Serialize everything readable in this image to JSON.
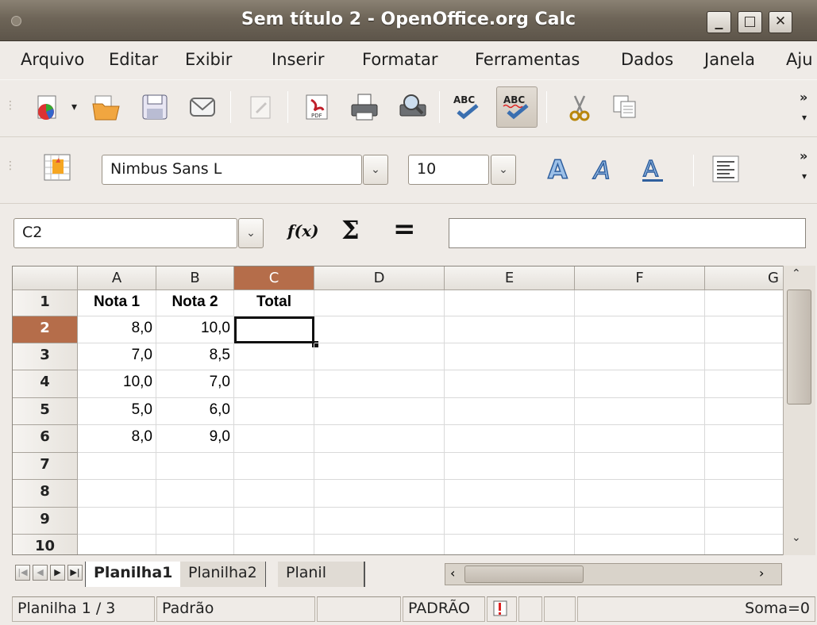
{
  "window": {
    "title": "Sem título 2 - OpenOffice.org Calc",
    "minimize_label": "_",
    "maximize_label": "□",
    "close_label": "✕"
  },
  "menu": {
    "items": [
      "Arquivo",
      "Editar",
      "Exibir",
      "Inserir",
      "Formatar",
      "Ferramentas",
      "Dados",
      "Janela",
      "Aju"
    ]
  },
  "toolbar": {
    "font_name": "Nimbus Sans L",
    "font_size": "10"
  },
  "formula_bar": {
    "name_box": "C2",
    "function_wizard_label": "f(x)",
    "sum_label": "Σ",
    "function_label": "=",
    "input_value": ""
  },
  "sheet": {
    "columns": [
      "A",
      "B",
      "C",
      "D",
      "E",
      "F",
      "G"
    ],
    "rows": [
      {
        "num": "1",
        "cells": [
          "Nota 1",
          "Nota 2",
          "Total",
          "",
          "",
          "",
          ""
        ]
      },
      {
        "num": "2",
        "cells": [
          "8,0",
          "10,0",
          "",
          "",
          "",
          "",
          ""
        ]
      },
      {
        "num": "3",
        "cells": [
          "7,0",
          "8,5",
          "",
          "",
          "",
          "",
          ""
        ]
      },
      {
        "num": "4",
        "cells": [
          "10,0",
          "7,0",
          "",
          "",
          "",
          "",
          ""
        ]
      },
      {
        "num": "5",
        "cells": [
          "5,0",
          "6,0",
          "",
          "",
          "",
          "",
          ""
        ]
      },
      {
        "num": "6",
        "cells": [
          "8,0",
          "9,0",
          "",
          "",
          "",
          "",
          ""
        ]
      },
      {
        "num": "7",
        "cells": [
          "",
          "",
          "",
          "",
          "",
          "",
          ""
        ]
      },
      {
        "num": "8",
        "cells": [
          "",
          "",
          "",
          "",
          "",
          "",
          ""
        ]
      },
      {
        "num": "9",
        "cells": [
          "",
          "",
          "",
          "",
          "",
          "",
          ""
        ]
      },
      {
        "num": "10",
        "cells": [
          "",
          "",
          "",
          "",
          "",
          "",
          ""
        ]
      }
    ],
    "selected_cell": "C2",
    "selection_color": "#b56d4a"
  },
  "sheet_tabs": {
    "tabs": [
      "Planilha1",
      "Planilha2",
      "Planil"
    ],
    "active": "Planilha1"
  },
  "status_bar": {
    "sheet_info": "Planilha 1 / 3",
    "style": "Padrão",
    "mode": "PADRÃO",
    "sum": "Soma=0"
  },
  "icons": [
    "new-document-icon",
    "open-folder-icon",
    "save-icon",
    "email-icon",
    "edit-file-icon",
    "export-pdf-icon",
    "print-icon",
    "page-preview-icon",
    "spellcheck-icon",
    "autospellcheck-icon",
    "cut-icon",
    "copy-icon",
    "styles-icon",
    "bold-icon",
    "italic-icon",
    "underline-icon",
    "align-left-icon"
  ]
}
